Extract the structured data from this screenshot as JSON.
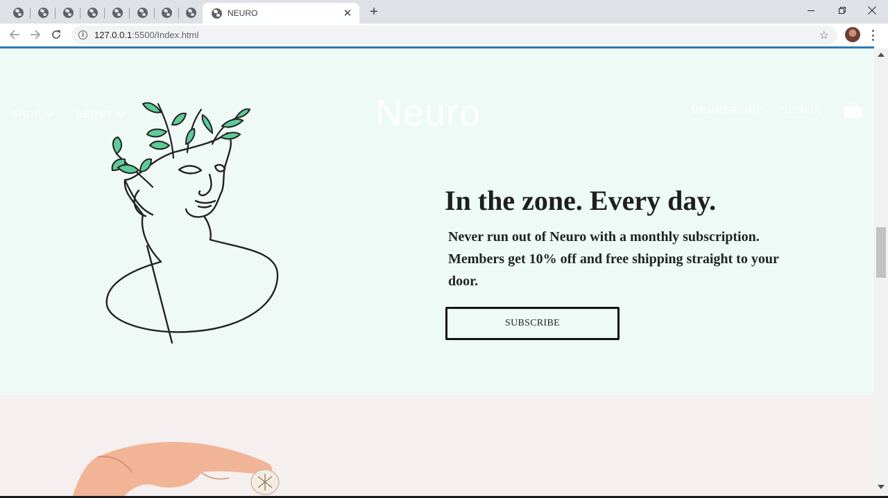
{
  "browser": {
    "active_tab_title": "NEURO",
    "close_tab_glyph": "✕",
    "new_tab_glyph": "+",
    "url_host": "127.0.0.1",
    "url_rest": ":5500/Index.html",
    "icons": [
      "globe-icon",
      "back-arrow-icon",
      "forward-arrow-icon",
      "reload-icon",
      "info-icon",
      "star-icon",
      "avatar",
      "menu-dots-icon",
      "minimize-icon",
      "restore-icon",
      "close-icon"
    ]
  },
  "site_nav": {
    "shop": "SHOP",
    "about": "ABOUT",
    "logo": "Neuro",
    "membership": "MEMBERSHIP",
    "sign_in": "SIGN IN"
  },
  "hero": {
    "headline": "In the zone. Every day.",
    "subtext": "Never run out of Neuro with a monthly subscription. Members get 10% off and free shipping straight to your door.",
    "cta": "SUBSCRIBE"
  },
  "colors": {
    "hero_bg": "#edfaf5",
    "second_bg": "#f5eff0",
    "leaf_green": "#5ecb98",
    "line_dark": "#222222"
  }
}
